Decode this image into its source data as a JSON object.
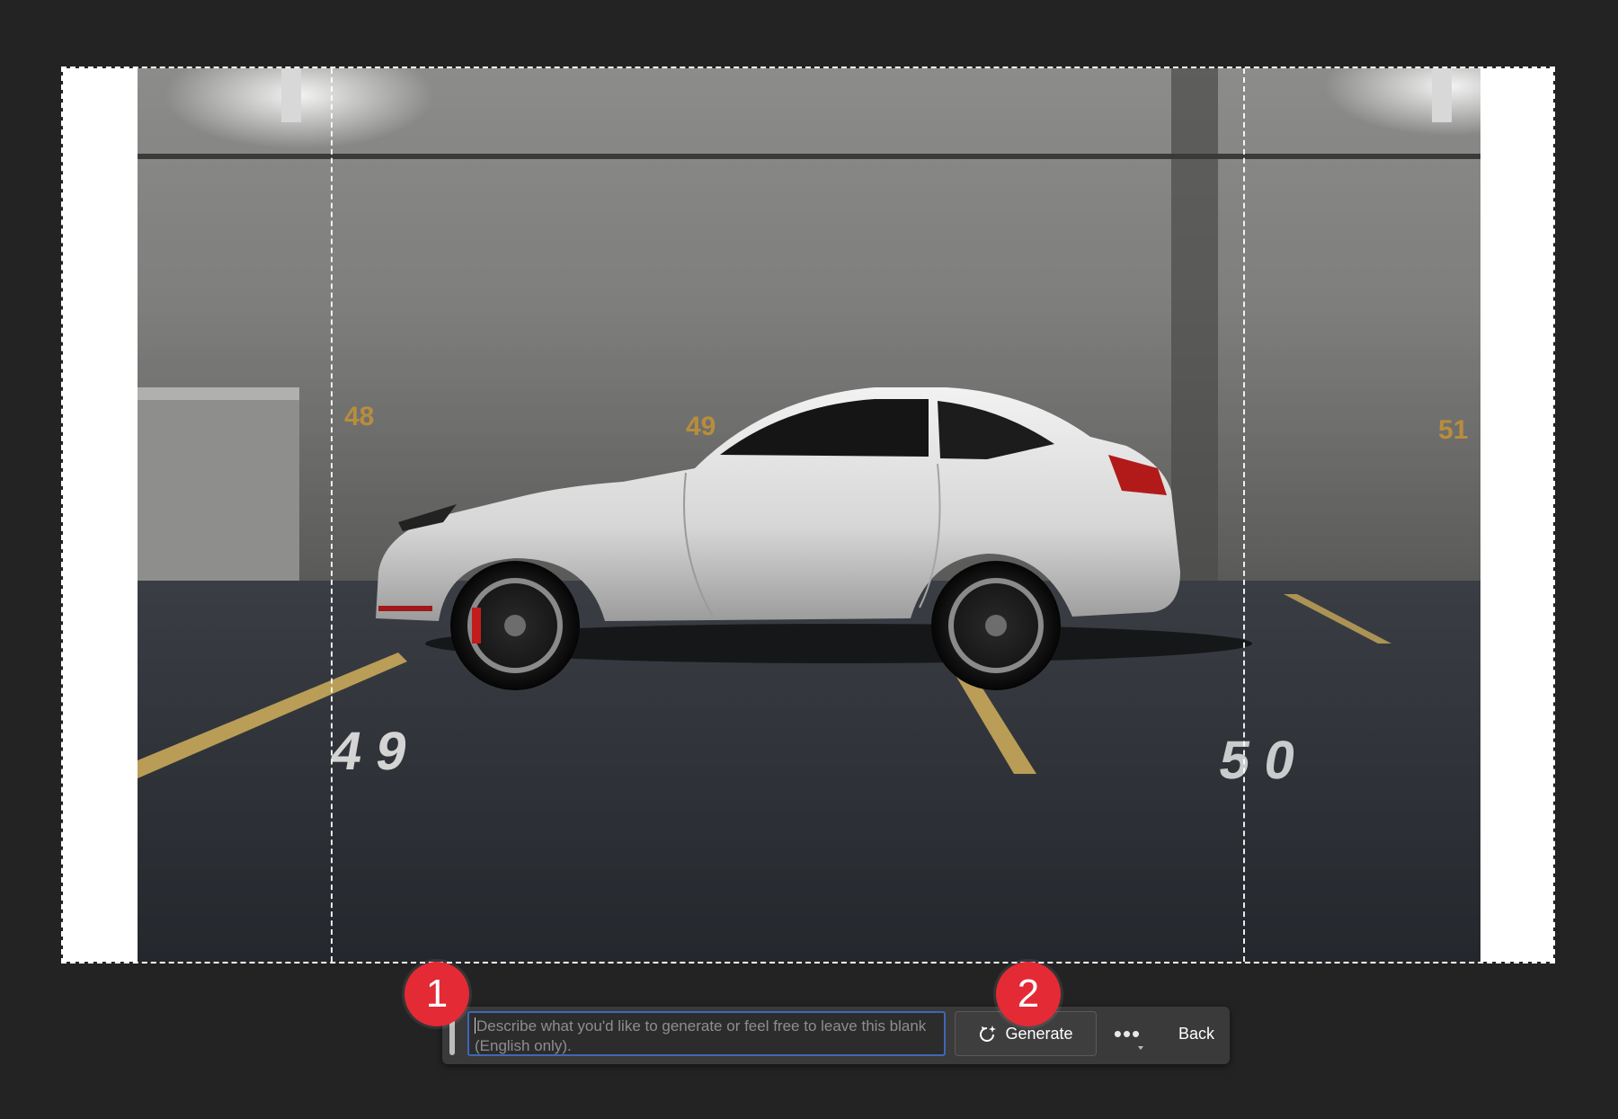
{
  "canvas": {
    "image_description": "white sports car parked in a dim concrete parking garage",
    "painted_numbers": [
      "48",
      "49",
      "51",
      "49",
      "50"
    ]
  },
  "taskbar": {
    "prompt_placeholder": "Describe what you'd like to generate or feel free to leave this blank (English only).",
    "generate_label": "Generate",
    "more_label": "•••",
    "back_label": "Back"
  },
  "annotations": {
    "marker_1": "1",
    "marker_2": "2"
  },
  "colors": {
    "background": "#232323",
    "taskbar": "#3a3a3a",
    "focus_border": "#3d67b8",
    "marker": "#e32a35"
  },
  "icons": {
    "generate": "generative-sparkle-refresh-icon",
    "more": "more-dots-icon"
  }
}
